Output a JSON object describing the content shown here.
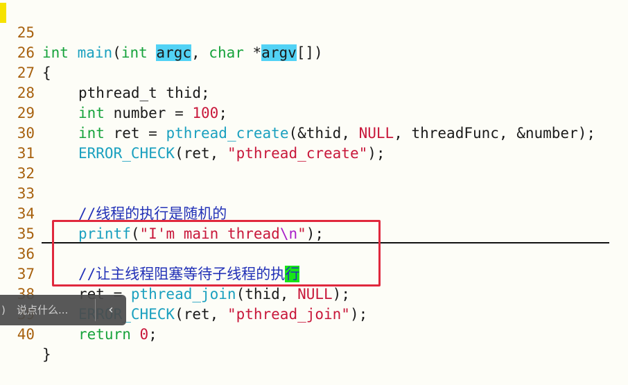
{
  "editor": {
    "lines": [
      {
        "n": "25"
      },
      {
        "n": "26",
        "t": "{"
      },
      {
        "n": "27",
        "t": "pthread_t thid;"
      },
      {
        "n": "28",
        "kw": "int",
        "t1": " number = ",
        "num": "100",
        "t2": ";"
      },
      {
        "n": "29",
        "kw": "int",
        "t1": " ret = ",
        "fn": "pthread_create",
        "t2": "(&thid, ",
        "nul": "NULL",
        "t3": ", threadFunc, &number);"
      },
      {
        "n": "30",
        "fn": "ERROR_CHECK",
        "t1": "(ret, ",
        "str": "\"pthread_create\"",
        "t2": ");"
      },
      {
        "n": "31"
      },
      {
        "n": "32"
      },
      {
        "n": "33",
        "cmt": "//线程的执行是随机的"
      },
      {
        "n": "34",
        "fn": "printf",
        "t1": "(",
        "s1": "\"I'm main thread",
        "esc": "\\n",
        "s2": "\"",
        "t2": ");"
      },
      {
        "n": "35"
      },
      {
        "n": "36",
        "cmt": "//让主线程阻塞等待子线程的执",
        "cur": "行"
      },
      {
        "n": "37",
        "t1": "ret = ",
        "fn": "pthread_join",
        "t2": "(thid, ",
        "nul": "NULL",
        "t3": ");"
      },
      {
        "n": "38",
        "fn": "ERROR_CHECK",
        "t1": "(ret, ",
        "str": "\"pthread_join\"",
        "t2": ");"
      },
      {
        "n": "39",
        "kw": "return",
        "t1": " ",
        "num": "0",
        "t2": ";"
      },
      {
        "n": "40",
        "t": "}"
      }
    ],
    "line25": {
      "kw1": "int",
      "fn": "main",
      "p1": "(",
      "kw2": "int",
      "sp": " ",
      "sel1": "argc",
      "p2": ", ",
      "kw3": "char",
      "p3": " *",
      "sel2": "argv",
      "p4": "[])"
    }
  },
  "comment_bar": {
    "placeholder": "说点什么...",
    "icon": "chat-bubble-icon",
    "collapse_icon": "chevron-left-icon",
    "collapse_glyph": "‹",
    "icon_glyph": ")"
  },
  "colors": {
    "keyword": "#17a33c",
    "function": "#1aa0bf",
    "string": "#c8173a",
    "comment": "#2231b7",
    "line_number": "#a7610e",
    "selection": "#52d2f5",
    "cursor": "#17e617",
    "annotation_box": "#e0283d"
  }
}
